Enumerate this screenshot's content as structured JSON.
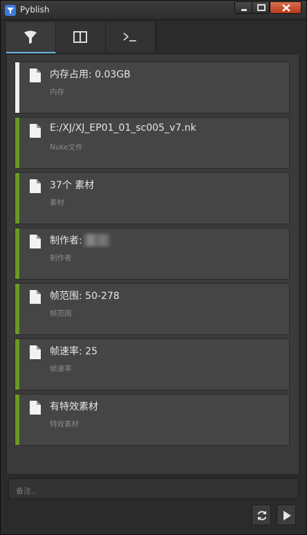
{
  "window": {
    "title": "Pyblish",
    "controls": [
      "minimize-icon",
      "maximize-icon",
      "close-icon"
    ]
  },
  "tabs": [
    {
      "name": "filter-icon",
      "active": true
    },
    {
      "name": "columns-icon",
      "active": false
    },
    {
      "name": "terminal-icon",
      "active": false
    }
  ],
  "items": [
    {
      "label": "内存占用: 0.03GB",
      "sublabel": "内存",
      "status_color": "#f0f0f0"
    },
    {
      "label": "E:/XJ/XJ_EP01_01_sc005_v7.nk",
      "sublabel": "Nuke文件",
      "status_color": "#6a9a21"
    },
    {
      "label": "37个 素材",
      "sublabel": "素材",
      "status_color": "#6a9a21"
    },
    {
      "label": "制作者:",
      "sublabel": "制作者",
      "status_color": "#6a9a21"
    },
    {
      "label": "帧范围: 50-278",
      "sublabel": "帧范围",
      "status_color": "#6a9a21"
    },
    {
      "label": "帧速率: 25",
      "sublabel": "帧速率",
      "status_color": "#6a9a21"
    },
    {
      "label": "有特效素材",
      "sublabel": "特效素材",
      "status_color": "#6a9a21"
    }
  ],
  "comment": {
    "placeholder": "备注.."
  },
  "footer": {
    "buttons": [
      "refresh-icon",
      "play-icon"
    ]
  },
  "colors": {
    "accent_tab": "#6bb7e6",
    "success": "#6a9a21",
    "info": "#f0f0f0"
  }
}
